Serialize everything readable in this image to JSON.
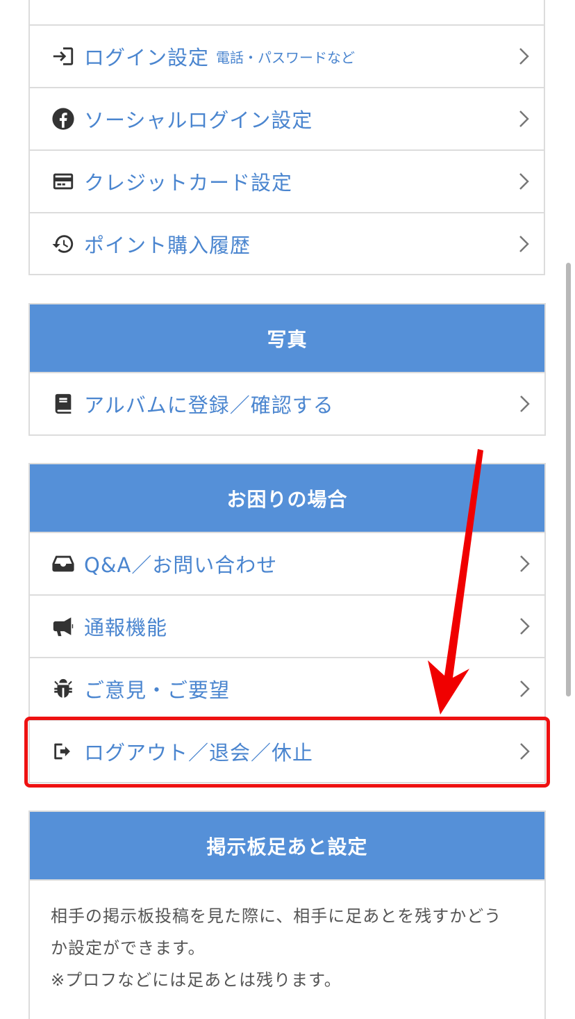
{
  "account_menu": {
    "items": [
      {
        "label": "ログイン設定",
        "sublabel": "電話・パスワードなど",
        "icon": "sign-in-icon"
      },
      {
        "label": "ソーシャルログイン設定",
        "icon": "facebook-icon"
      },
      {
        "label": "クレジットカード設定",
        "icon": "credit-card-icon"
      },
      {
        "label": "ポイント購入履歴",
        "icon": "history-icon"
      }
    ]
  },
  "photo_section": {
    "title": "写真",
    "items": [
      {
        "label": "アルバムに登録／確認する",
        "icon": "book-icon"
      }
    ]
  },
  "help_section": {
    "title": "お困りの場合",
    "items": [
      {
        "label": "Q&A／お問い合わせ",
        "icon": "inbox-icon"
      },
      {
        "label": "通報機能",
        "icon": "megaphone-icon"
      },
      {
        "label": "ご意見・ご要望",
        "icon": "bug-icon"
      },
      {
        "label": "ログアウト／退会／休止",
        "icon": "sign-out-icon"
      }
    ]
  },
  "footprint_section": {
    "title": "掲示板足あと設定",
    "description_line1": "相手の掲示板投稿を見た際に、相手に足あとを残すかどう",
    "description_line2": "か設定ができます。",
    "description_note": "※プロフなどには足あとは残ります。"
  },
  "colors": {
    "header_bg": "#5590d8",
    "link_text": "#4a85cf",
    "highlight": "#ee1111",
    "border": "#dcdcdc"
  }
}
